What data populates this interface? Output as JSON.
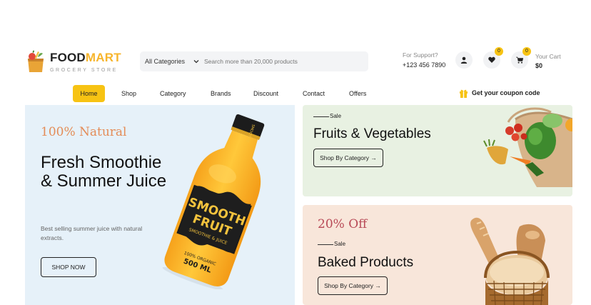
{
  "brand": {
    "name_part1": "FOOD",
    "name_part2": "MART",
    "tagline": "GROCERY STORE"
  },
  "search": {
    "category_selected": "All Categories",
    "placeholder": "Search more than 20,000 products"
  },
  "support": {
    "label": "For Support?",
    "phone": "+123 456 7890"
  },
  "icons": {
    "user": "user-icon",
    "wishlist": "heart-icon",
    "cart": "cart-icon"
  },
  "wishlist": {
    "count": "0"
  },
  "cart": {
    "count": "0",
    "label": "Your Cart",
    "total": "$0"
  },
  "nav": {
    "items": [
      {
        "label": "Home",
        "active": true
      },
      {
        "label": "Shop"
      },
      {
        "label": "Category"
      },
      {
        "label": "Brands"
      },
      {
        "label": "Discount"
      },
      {
        "label": "Contact"
      },
      {
        "label": "Offers"
      }
    ],
    "coupon": "Get your coupon code"
  },
  "hero": {
    "tag": "100% Natural",
    "title": "Fresh Smoothie & Summer Juice",
    "description": "Best selling summer juice with natural extracts.",
    "button": "SHOP NOW",
    "bottle_label_top": "SMOOTHIE",
    "bottle_label_main1": "SMOOTH",
    "bottle_label_main2": "FRUIT",
    "bottle_label_sub": "SMOOTHIE & JUICE",
    "bottle_label_bottom1": "100% ORGANIC",
    "bottle_label_bottom2": "500 ML"
  },
  "promo1": {
    "sale_label": "Sale",
    "title": "Fruits & Vegetables",
    "button": "Shop By Category →"
  },
  "promo2": {
    "discount": "20% Off",
    "sale_label": "Sale",
    "title": "Baked Products",
    "button": "Shop By Category →"
  },
  "colors": {
    "accent": "#f7c313",
    "hero_bg": "#e6f1f9",
    "promo1_bg": "#e8f1e2",
    "promo2_bg": "#f8e6da",
    "tag_orange": "#e48c57",
    "discount_red": "#b84a57"
  }
}
